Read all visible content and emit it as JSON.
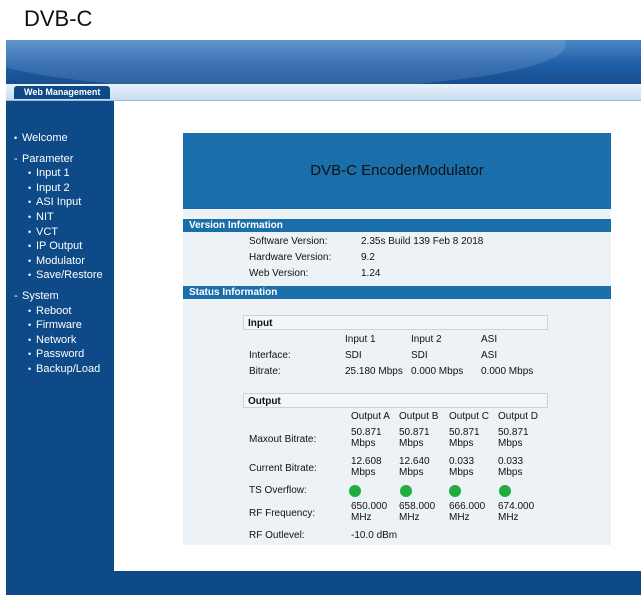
{
  "caption": "DVB-C",
  "tab": {
    "label": "Web Management"
  },
  "sidebar": {
    "items": [
      {
        "label": "Welcome",
        "level": 1
      },
      {
        "label": "Parameter",
        "level": 1,
        "group": true
      },
      {
        "label": "Input 1",
        "level": 2
      },
      {
        "label": "Input 2",
        "level": 2
      },
      {
        "label": "ASI Input",
        "level": 2
      },
      {
        "label": "NIT",
        "level": 2
      },
      {
        "label": "VCT",
        "level": 2
      },
      {
        "label": "IP Output",
        "level": 2
      },
      {
        "label": "Modulator",
        "level": 2
      },
      {
        "label": "Save/Restore",
        "level": 2
      },
      {
        "label": "System",
        "level": 1,
        "group": true
      },
      {
        "label": "Reboot",
        "level": 2
      },
      {
        "label": "Firmware",
        "level": 2
      },
      {
        "label": "Network",
        "level": 2
      },
      {
        "label": "Password",
        "level": 2
      },
      {
        "label": "Backup/Load",
        "level": 2
      }
    ]
  },
  "main": {
    "title": "DVB-C EncoderModulator",
    "version": {
      "header": "Version Information",
      "software_label": "Software Version:",
      "software_value": "2.35s Build 139 Feb 8 2018",
      "hardware_label": "Hardware Version:",
      "hardware_value": "9.2",
      "web_label": "Web Version:",
      "web_value": "1.24"
    },
    "status": {
      "header": "Status Information",
      "input": {
        "title": "Input",
        "columns": [
          "Input 1",
          "Input 2",
          "ASI"
        ],
        "interface_label": "Interface:",
        "interface": [
          "SDI",
          "SDI",
          "ASI"
        ],
        "bitrate_label": "Bitrate:",
        "bitrate": [
          "25.180 Mbps",
          "0.000 Mbps",
          "0.000 Mbps"
        ]
      },
      "output": {
        "title": "Output",
        "columns": [
          "Output A",
          "Output B",
          "Output C",
          "Output D"
        ],
        "maxout_label": "Maxout Bitrate:",
        "maxout": [
          [
            "50.871",
            "Mbps"
          ],
          [
            "50.871",
            "Mbps"
          ],
          [
            "50.871",
            "Mbps"
          ],
          [
            "50.871",
            "Mbps"
          ]
        ],
        "current_label": "Current Bitrate:",
        "current": [
          [
            "12.608",
            "Mbps"
          ],
          [
            "12.640",
            "Mbps"
          ],
          [
            "0.033",
            "Mbps"
          ],
          [
            "0.033",
            "Mbps"
          ]
        ],
        "overflow_label": "TS Overflow:",
        "overflow_color": "#1fae3e",
        "rf_freq_label": "RF Frequency:",
        "rf_freq": [
          [
            "650.000",
            "MHz"
          ],
          [
            "658.000",
            "MHz"
          ],
          [
            "666.000",
            "MHz"
          ],
          [
            "674.000",
            "MHz"
          ]
        ],
        "rf_level_label": "RF Outlevel:",
        "rf_level": "-10.0 dBm"
      }
    }
  }
}
